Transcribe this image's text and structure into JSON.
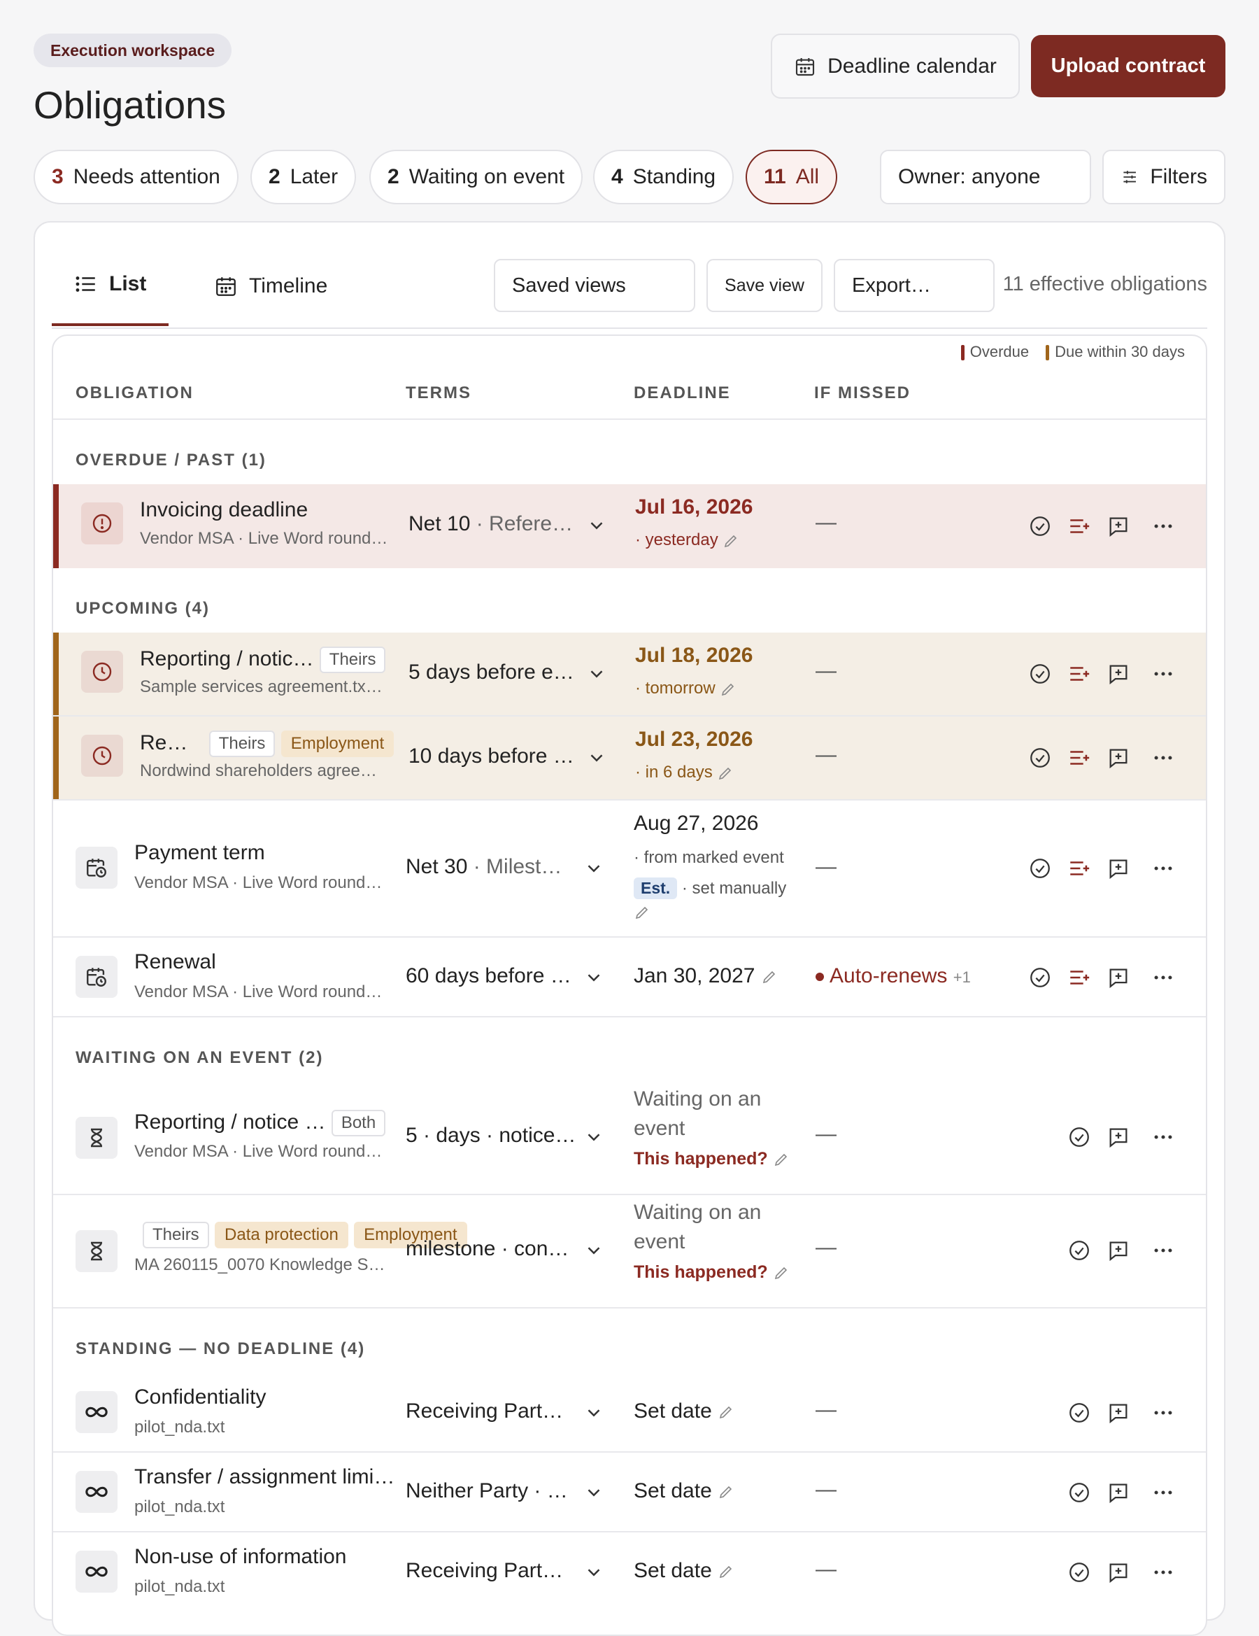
{
  "header": {
    "workspace_badge": "Execution workspace",
    "title": "Obligations",
    "calendar_button": "Deadline calendar",
    "upload_button": "Upload contract"
  },
  "filters": {
    "pills": [
      {
        "count": "3",
        "label": "Needs attention"
      },
      {
        "count": "2",
        "label": "Later"
      },
      {
        "count": "2",
        "label": "Waiting on event"
      },
      {
        "count": "4",
        "label": "Standing"
      },
      {
        "count": "11",
        "label": "All"
      }
    ],
    "owner": "Owner: anyone",
    "filters_button": "Filters"
  },
  "toolbar": {
    "tab_list": "List",
    "tab_timeline": "Timeline",
    "saved_views": "Saved views",
    "save_view": "Save view",
    "export": "Export…",
    "count": "11 effective obligations"
  },
  "legend": {
    "overdue": "Overdue",
    "due_soon": "Due within 30 days",
    "overdue_color": "#8b2a22",
    "due_color": "#a0651b"
  },
  "columns": {
    "obligation": "OBLIGATION",
    "terms": "TERMS",
    "deadline": "DEADLINE",
    "if_missed": "IF MISSED"
  },
  "sections": {
    "overdue": "OVERDUE / PAST (1)",
    "upcoming": "UPCOMING (4)",
    "waiting": "WAITING ON AN EVENT (2)",
    "standing": "STANDING — NO DEADLINE (4)"
  },
  "rows": [
    {
      "name": "Invoicing deadline",
      "sub": "Vendor MSA · Live Word round…",
      "terms": "Net 10",
      "terms_more": " · Refere…",
      "deadline": "Jul 16, 2026",
      "deadline_sub": "· yesterday",
      "missed": "—",
      "icon": "alert-circle-icon"
    },
    {
      "name": "Reporting / notic…",
      "tag1": "Theirs",
      "sub": "Sample services agreement.tx…",
      "terms": "5 days before e…",
      "deadline": "Jul 18, 2026",
      "deadline_sub": "· tomorrow",
      "missed": "—",
      "icon": "clock-icon"
    },
    {
      "name": "Re…",
      "tag1": "Theirs",
      "tag2": "Employment",
      "sub": "Nordwind shareholders agree…",
      "terms": "10 days before …",
      "deadline": "Jul 23, 2026",
      "deadline_sub": "· in 6 days",
      "missed": "—",
      "icon": "clock-icon"
    },
    {
      "name": "Payment term",
      "sub": "Vendor MSA · Live Word round…",
      "terms": "Net 30",
      "terms_more": " · Milest…",
      "deadline": "Aug 27, 2026",
      "deadline_sub": "· from marked event",
      "est": "Est.",
      "est_sub": "· set manually",
      "missed": "—",
      "icon": "calendar-clock-icon"
    },
    {
      "name": "Renewal",
      "sub": "Vendor MSA · Live Word round…",
      "terms": "60 days before …",
      "deadline": "Jan 30, 2027",
      "missed": "Auto-renews",
      "missed_more": "+1",
      "icon": "calendar-clock-icon"
    },
    {
      "name": "Reporting / notice …",
      "tag1": "Both",
      "sub": "Vendor MSA · Live Word round…",
      "terms": "5 · days · notice…",
      "deadline": "Waiting on an event",
      "happened": "This happened?",
      "missed": "—",
      "icon": "hourglass-icon"
    },
    {
      "name": "",
      "tag1": "Theirs",
      "tag2": "Data protection",
      "tag3": "Employment",
      "sub": "MA 260115_0070 Knowledge S…",
      "terms": "milestone · con…",
      "deadline": "Waiting on an event",
      "happened": "This happened?",
      "missed": "—",
      "icon": "hourglass-icon"
    },
    {
      "name": "Confidentiality",
      "sub": "pilot_nda.txt",
      "terms": "Receiving Part…",
      "deadline": "Set date",
      "missed": "—",
      "icon": "infinity-icon"
    },
    {
      "name": "Transfer / assignment limi…",
      "sub": "pilot_nda.txt",
      "terms": "Neither Party · …",
      "deadline": "Set date",
      "missed": "—",
      "icon": "infinity-icon"
    },
    {
      "name": "Non-use of information",
      "sub": "pilot_nda.txt",
      "terms": "Receiving Part…",
      "deadline": "Set date",
      "missed": "—",
      "icon": "infinity-icon"
    }
  ]
}
